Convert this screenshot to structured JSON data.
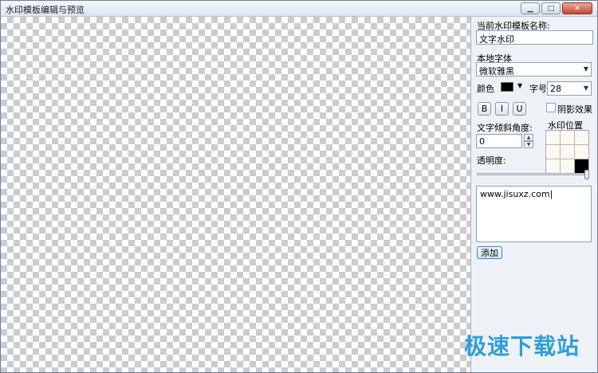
{
  "window": {
    "title": "水印模板编辑与预览",
    "min_icon": "minimize-icon",
    "max_icon": "maximize-icon",
    "close_icon": "close-icon"
  },
  "panel": {
    "template_name_label": "当前水印模板名称:",
    "template_name_value": "文字水印",
    "font_label": "本地字体",
    "font_value": "微软雅黑",
    "color_label": "颜色",
    "color_value": "#000000",
    "size_label": "字号",
    "size_value": "28",
    "bold_label": "B",
    "italic_label": "I",
    "underline_label": "U",
    "shadow_label": "阴影效果",
    "angle_label": "文字倾斜角度:",
    "angle_value": "0",
    "position_label": "水印位置",
    "opacity_label": "透明度:",
    "opacity_value": 1.0,
    "text_value": "www.jisuxz.com",
    "add_label": "添加"
  },
  "branding": {
    "watermark": "极速下载站"
  }
}
